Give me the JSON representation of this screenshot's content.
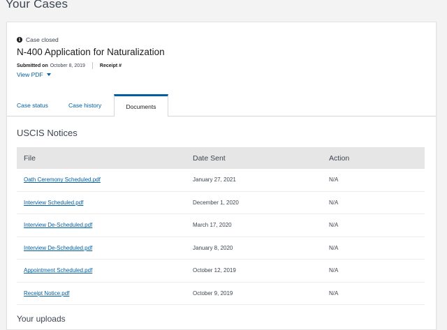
{
  "page": {
    "title": "Your Cases"
  },
  "case": {
    "status_label": "Case closed",
    "status_icon": "info-icon",
    "form_title": "N-400 Application for Naturalization",
    "submitted_label": "Submitted on",
    "submitted_date": "October 8, 2019",
    "receipt_label": "Receipt #",
    "view_pdf_label": "View PDF"
  },
  "tabs": [
    {
      "label": "Case status",
      "active": false
    },
    {
      "label": "Case history",
      "active": false
    },
    {
      "label": "Documents",
      "active": true
    }
  ],
  "notices": {
    "section_title": "USCIS Notices",
    "columns": [
      "File",
      "Date Sent",
      "Action"
    ],
    "rows": [
      {
        "file": "Oath Ceremony Scheduled.pdf",
        "date": "January 27, 2021",
        "action": "N/A"
      },
      {
        "file": "Interview Scheduled.pdf",
        "date": "December 1, 2020",
        "action": "N/A"
      },
      {
        "file": "Interview De-Scheduled.pdf",
        "date": "March 17, 2020",
        "action": "N/A"
      },
      {
        "file": "Interview De-Scheduled.pdf",
        "date": "January 8, 2020",
        "action": "N/A"
      },
      {
        "file": "Appointment Scheduled.pdf",
        "date": "October 12, 2019",
        "action": "N/A"
      },
      {
        "file": "Receipt Notice.pdf",
        "date": "October 9, 2019",
        "action": "N/A"
      }
    ]
  },
  "next_section": {
    "title": "Your uploads"
  },
  "colors": {
    "link": "#005ea2",
    "tab_accent": "#005ea2",
    "header_bg": "#e6e6e6"
  }
}
